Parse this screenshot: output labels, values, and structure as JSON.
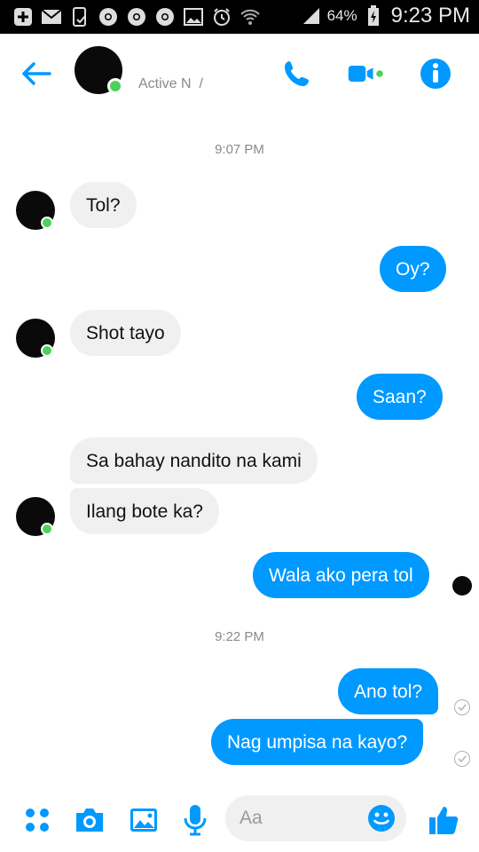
{
  "status_bar": {
    "battery_percent": "64%",
    "time": "9:23 PM",
    "icons": [
      "plus-box-icon",
      "mail-icon",
      "phone-check-icon",
      "chrome-icon",
      "chrome-icon",
      "chrome-icon",
      "image-icon",
      "alarm-icon",
      "wifi-icon",
      "signal-icon",
      "battery-charging-icon"
    ]
  },
  "header": {
    "status_text": "Active N  /",
    "icons": {
      "back": "back-arrow-icon",
      "call": "phone-icon",
      "video": "video-camera-icon",
      "info": "info-icon"
    },
    "accent_color": "#0099ff"
  },
  "conversation": {
    "timestamps": [
      "9:07 PM",
      "9:22 PM"
    ],
    "messages": [
      {
        "side": "in",
        "text": "Tol?"
      },
      {
        "side": "out",
        "text": "Oy?"
      },
      {
        "side": "in",
        "text": "Shot tayo"
      },
      {
        "side": "out",
        "text": "Saan?"
      },
      {
        "side": "in",
        "text": "Sa bahay nandito na kami"
      },
      {
        "side": "in",
        "text": "Ilang bote ka?"
      },
      {
        "side": "out",
        "text": "Wala ako pera tol"
      },
      {
        "side": "out",
        "text": "Ano tol?"
      },
      {
        "side": "out",
        "text": "Nag umpisa na kayo?"
      }
    ]
  },
  "composer": {
    "placeholder": "Aa",
    "icons": {
      "more": "four-dots-icon",
      "camera": "camera-icon",
      "gallery": "image-icon",
      "mic": "microphone-icon",
      "emoji": "emoji-icon",
      "like": "thumbs-up-icon"
    }
  }
}
